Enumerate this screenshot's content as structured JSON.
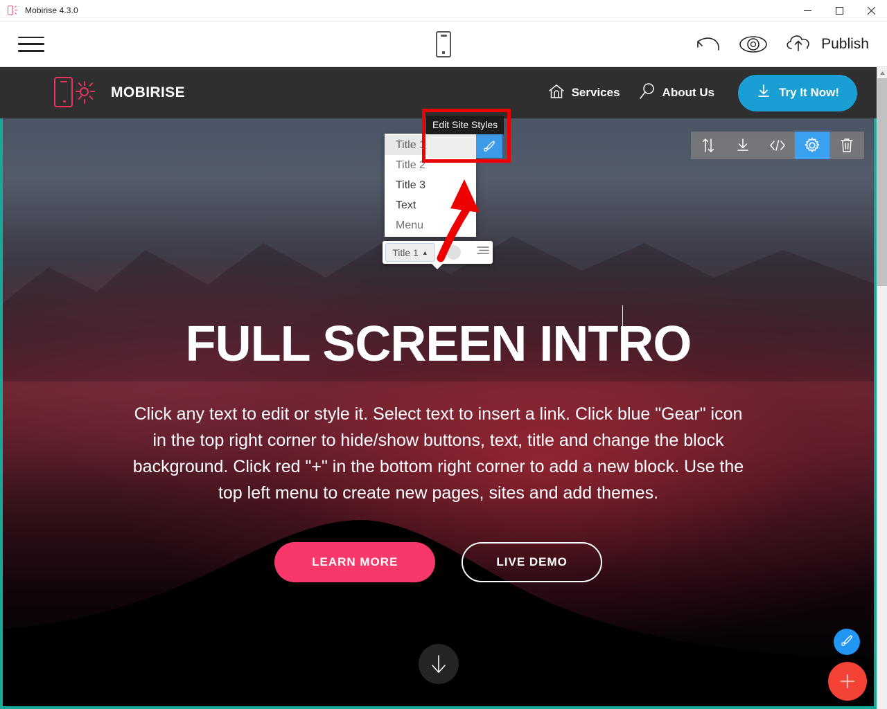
{
  "window": {
    "title": "Mobirise 4.3.0",
    "app_icon": "mobirise-logo-icon",
    "minimize_label": "—",
    "maximize_label": "□",
    "close_label": "✕"
  },
  "editor_toolbar": {
    "menu_icon": "hamburger-menu-icon",
    "device_icon": "mobile-preview-icon",
    "undo_icon": "undo-icon",
    "preview_icon": "eye-preview-icon",
    "publish_icon": "cloud-upload-icon",
    "publish_label": "Publish"
  },
  "site": {
    "navbar": {
      "brand_name": "MOBIRISE",
      "brand_icon": "mobirise-phone-sun-icon",
      "links": [
        {
          "label": "Services",
          "icon": "home-icon"
        },
        {
          "label": "About Us",
          "icon": "search-icon"
        }
      ],
      "cta": {
        "label": "Try It Now!",
        "icon": "download-icon",
        "color": "#1a9fd4"
      }
    },
    "hero": {
      "title": "FULL SCREEN INTRO",
      "paragraph": "Click any text to edit or style it. Select text to insert a link. Click blue \"Gear\" icon in the top right corner to hide/show buttons, text, title and change the block background. Click red \"+\" in the bottom right corner to add a new block. Use the top left menu to create new pages, sites and add themes.",
      "primary_button": {
        "label": "LEARN MORE",
        "color": "#f8386a"
      },
      "secondary_button": {
        "label": "LIVE DEMO"
      },
      "scroll_icon": "scroll-down-arrow-icon"
    }
  },
  "block_toolbar": {
    "buttons": [
      {
        "name": "move-block",
        "icon": "move-up-down-icon",
        "active": false
      },
      {
        "name": "save-block",
        "icon": "download-icon",
        "active": false
      },
      {
        "name": "edit-code",
        "icon": "code-brackets-icon",
        "active": false
      },
      {
        "name": "block-settings",
        "icon": "gear-icon",
        "active": true
      },
      {
        "name": "delete-block",
        "icon": "trash-icon",
        "active": false
      }
    ],
    "active_color": "#3aa0f0"
  },
  "style_editor": {
    "tooltip": "Edit Site Styles",
    "brush_icon": "paintbrush-icon",
    "brush_color": "#3c9ae8",
    "highlight_color": "#ec0000",
    "dropdown_options": [
      {
        "label": "Title 1",
        "selected": true
      },
      {
        "label": "Title 2",
        "selected": false
      },
      {
        "label": "Title 3",
        "selected": false
      },
      {
        "label": "Text",
        "selected": false
      },
      {
        "label": "Menu",
        "selected": false
      }
    ],
    "toolbar": {
      "tag_label": "Title 1",
      "tag_caret": "▲",
      "color_swatch": "#e0e0e0",
      "align_icon": "text-align-icon"
    }
  },
  "fabs": {
    "style_fab": {
      "icon": "paintbrush-icon",
      "color": "#2196f3"
    },
    "add_fab": {
      "icon": "plus-icon",
      "label": "+",
      "color": "#f44336"
    }
  },
  "selection": {
    "outline_color": "#18a99a"
  },
  "scrollbar": {
    "up_icon": "scroll-up-arrow-icon"
  }
}
